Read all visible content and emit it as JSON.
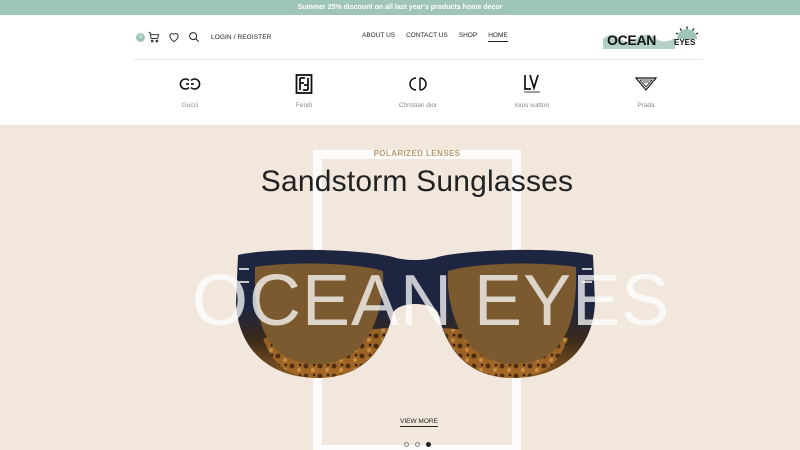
{
  "promo": {
    "text": "Summer 25% discount on all last year's products home decor"
  },
  "header": {
    "cart_count": "0",
    "login_label": "LOGIN / REGISTER",
    "nav": [
      {
        "label": "ABOUT US"
      },
      {
        "label": "CONTACT US"
      },
      {
        "label": "SHOP"
      },
      {
        "label": "HOME",
        "active": true
      }
    ],
    "logo": {
      "main": "OCEAN",
      "sub": "EYES"
    }
  },
  "brands": [
    {
      "name": "Gucci",
      "icon": "gucci-logo-icon"
    },
    {
      "name": "Fendi",
      "icon": "fendi-logo-icon"
    },
    {
      "name": "Christian dior",
      "icon": "dior-logo-icon"
    },
    {
      "name": "louis vuitton",
      "icon": "louis-vuitton-logo-icon"
    },
    {
      "name": "Prada",
      "icon": "prada-logo-icon"
    }
  ],
  "hero": {
    "eyebrow": "POLARIZED LENSES",
    "title": "Sandstorm Sunglasses",
    "watermark": "OCEAN EYES",
    "cta": "VIEW MORE",
    "slides": 3,
    "active_slide": 3
  },
  "colors": {
    "accent": "#9fc4b8",
    "hero_bg": "#f2e7dd",
    "eyebrow": "#b89a6e",
    "frame_navy": "#1d2540",
    "lens_brown": "#7a5a2e"
  }
}
